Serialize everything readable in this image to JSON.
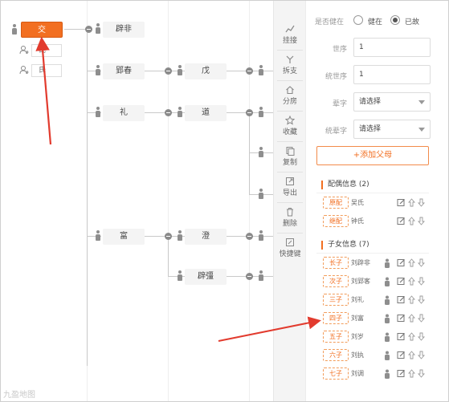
{
  "tree": {
    "nodes": [
      {
        "id": "jiao",
        "label": "交",
        "active": true
      },
      {
        "id": "pifei",
        "label": "辟非",
        "active": false
      },
      {
        "id": "yingchun",
        "label": "郢春",
        "active": false
      },
      {
        "id": "wu",
        "label": "戊",
        "active": false
      },
      {
        "id": "li",
        "label": "礼",
        "active": false
      },
      {
        "id": "dao",
        "label": "道",
        "active": false
      },
      {
        "id": "fu",
        "label": "富",
        "active": false
      },
      {
        "id": "cheng",
        "label": "澄",
        "active": false
      },
      {
        "id": "piqiang",
        "label": "辟彊",
        "active": false
      }
    ],
    "spouses": [
      {
        "id": "spouse1",
        "label": "氏"
      },
      {
        "id": "spouse2",
        "label": "氏"
      }
    ]
  },
  "toolbar": {
    "items": [
      {
        "id": "guajie",
        "label": "挂接",
        "icon": "link-chart-icon"
      },
      {
        "id": "chaizhi",
        "label": "拆支",
        "icon": "split-icon"
      },
      {
        "id": "fenfang",
        "label": "分房",
        "icon": "house-icon"
      },
      {
        "id": "shoucang",
        "label": "收藏",
        "icon": "star-icon"
      },
      {
        "id": "fuzhi",
        "label": "复制",
        "icon": "copy-icon"
      },
      {
        "id": "daochu",
        "label": "导出",
        "icon": "export-icon"
      },
      {
        "id": "shanchu",
        "label": "删除",
        "icon": "trash-icon"
      },
      {
        "id": "kuaijiejian",
        "label": "快捷键",
        "icon": "shortcut-icon"
      }
    ]
  },
  "panel": {
    "alive_label": "是否健在",
    "alive_options": [
      "健在",
      "已故"
    ],
    "alive_selected": "已故",
    "fields": [
      {
        "id": "shixu",
        "label": "世序",
        "value": "1",
        "type": "input"
      },
      {
        "id": "tongshixu",
        "label": "统世序",
        "value": "1",
        "type": "input"
      },
      {
        "id": "beizi",
        "label": "辈字",
        "value": "请选择",
        "type": "select"
      },
      {
        "id": "tongbeizi",
        "label": "统辈字",
        "value": "请选择",
        "type": "select"
      }
    ],
    "add_parent": "+添加父母",
    "spouse_title": "配偶信息 (2)",
    "spouses": [
      {
        "tag": "原配",
        "name": "吴氏"
      },
      {
        "tag": "继配",
        "name": "钟氏"
      }
    ],
    "children_title": "子女信息 (7)",
    "children": [
      {
        "tag": "长子",
        "name": "刘辟非"
      },
      {
        "tag": "次子",
        "name": "刘郢客"
      },
      {
        "tag": "三子",
        "name": "刘礼"
      },
      {
        "tag": "四子",
        "name": "刘富"
      },
      {
        "tag": "五子",
        "name": "刘岁"
      },
      {
        "tag": "六子",
        "name": "刘执"
      },
      {
        "tag": "七子",
        "name": "刘调"
      }
    ]
  },
  "watermark": "九盈地图"
}
